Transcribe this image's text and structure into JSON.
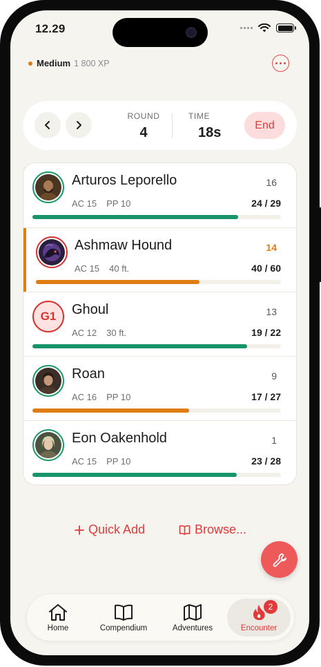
{
  "status": {
    "time": "12.29"
  },
  "encounter": {
    "difficulty": "Medium",
    "xp": "1 800 XP"
  },
  "round_bar": {
    "round_label": "ROUND",
    "round_value": "4",
    "time_label": "TIME",
    "time_value": "18s",
    "end_label": "End"
  },
  "combatants": [
    {
      "name": "Arturos Leporello",
      "ac": "AC 15",
      "extra": "PP 10",
      "initiative": "16",
      "hp": "24 / 29",
      "hp_current": 24,
      "hp_max": 29,
      "type": "player",
      "active": false
    },
    {
      "name": "Ashmaw Hound",
      "ac": "AC 15",
      "extra": "40 ft.",
      "initiative": "14",
      "hp": "40 / 60",
      "hp_current": 40,
      "hp_max": 60,
      "type": "enemy",
      "active": true
    },
    {
      "name": "Ghoul",
      "ac": "AC 12",
      "extra": "30 ft.",
      "initiative": "13",
      "hp": "19 / 22",
      "hp_current": 19,
      "hp_max": 22,
      "type": "token",
      "token": "G1",
      "active": false
    },
    {
      "name": "Roan",
      "ac": "AC 16",
      "extra": "PP 10",
      "initiative": "9",
      "hp": "17 / 27",
      "hp_current": 17,
      "hp_max": 27,
      "type": "player",
      "active": false
    },
    {
      "name": "Eon Oakenhold",
      "ac": "AC 15",
      "extra": "PP 10",
      "initiative": "1",
      "hp": "23 / 28",
      "hp_current": 23,
      "hp_max": 28,
      "type": "player",
      "active": false
    }
  ],
  "actions": {
    "quick_add": "Quick Add",
    "browse": "Browse..."
  },
  "tabs": [
    {
      "label": "Home",
      "icon": "home-icon"
    },
    {
      "label": "Compendium",
      "icon": "book-icon"
    },
    {
      "label": "Adventures",
      "icon": "map-icon"
    },
    {
      "label": "Encounter",
      "icon": "flame-icon",
      "badge": "2"
    }
  ],
  "colors": {
    "accent": "#e03a3a",
    "hp_good": "#17946a",
    "hp_warn": "#e07d12",
    "active_turn": "#e07d12"
  }
}
